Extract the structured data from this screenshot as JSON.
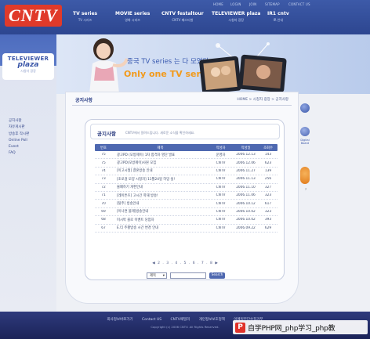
{
  "logo": "CNTV",
  "utility_links": [
    "HOME",
    "LOGIN",
    "JOIN",
    "SITEMAP",
    "CONTACT US"
  ],
  "nav": [
    {
      "label": "TV series",
      "sub": "TV 시리즈"
    },
    {
      "label": "MOVIE series",
      "sub": "영화 시리즈"
    },
    {
      "label": "CNTV festaltour",
      "sub": "CNTV 페스티벌"
    },
    {
      "label": "TELEVIEWER plaza",
      "sub": "시청자 광장"
    },
    {
      "label": "IR1 cntv",
      "sub": "IR 안내"
    }
  ],
  "sidebar": {
    "logo_top": "TELEVIEWER",
    "logo_mid": "plaza",
    "logo_sub": "시청자 광장",
    "items": [
      {
        "label": "공지사항"
      },
      {
        "label": "자유게시판"
      },
      {
        "label": "방송후 작시판"
      },
      {
        "label": "Online Poll"
      },
      {
        "label": "Event"
      },
      {
        "label": "FAQ"
      }
    ]
  },
  "banner": {
    "slogan_ko": "중국 TV series 는 다 모였다",
    "slogan_en": "Only one TV series!"
  },
  "page_title": "공지사항",
  "breadcrumb": "HOME > 시청자 광장 > 공지사항",
  "board": {
    "title": "공지사항",
    "description": "CNTV에서 알려드립니다. 새로운 소식을 확인하세요.",
    "columns": [
      "번호",
      "제목",
      "작성자",
      "작성일",
      "조회수"
    ],
    "rows": [
      {
        "no": "75",
        "title": "광고PD (모방제이) 1차 합격자 명단 발표",
        "author": "운영자",
        "date": "2006.12.13",
        "views": "143"
      },
      {
        "no": "75",
        "title": "광고PD(모방제이)사원 모집",
        "author": "CNTV",
        "date": "2006.12.06",
        "views": "623"
      },
      {
        "no": "74",
        "title": "[이고시절] 결혼방송 안내",
        "author": "CNTV",
        "date": "2006.11.27",
        "views": "139"
      },
      {
        "no": "73",
        "title": "[조로걸 모양 시청자] 11월24일 하망 실!",
        "author": "CNTV",
        "date": "2006.11.13",
        "views": "256"
      },
      {
        "no": "72",
        "title": "물폐하기 개편안내",
        "author": "CNTV",
        "date": "2006.11.10",
        "views": "327"
      },
      {
        "no": "71",
        "title": "[레이튼즈] 고시간 학재 방송!",
        "author": "CNTV",
        "date": "2006.11.06",
        "views": "323"
      },
      {
        "no": "70",
        "title": "[탈주] 방송안내",
        "author": "CNTV",
        "date": "2006.10.12",
        "views": "617"
      },
      {
        "no": "69",
        "title": "[이나면 불래]방송안내",
        "author": "CNTV",
        "date": "2006.10.02",
        "views": "323"
      },
      {
        "no": "68",
        "title": "미시박 블로 이벤트 당첨자",
        "author": "CNTV",
        "date": "2006.10.02",
        "views": "393"
      },
      {
        "no": "67",
        "title": "E.티 주황방송 시간 변경 안내",
        "author": "CNTV",
        "date": "2006.09.22",
        "views": "629"
      }
    ],
    "pagination": "◀ 2 . 3 . 4 . 5 . 6 . 7 . 8 ▶",
    "search_select": "제목",
    "search_button": "Search"
  },
  "right_widgets": {
    "label": "Digital Board",
    "bottom": "7"
  },
  "footer": {
    "links": [
      "회사정보바로가기",
      "Contact US",
      "CNTV패밀리",
      "개인정보보호정책",
      "이메일무단수집거부"
    ],
    "copyright": "Copyright (c) 2006 CNTV. All Rights Reserved."
  },
  "watermark": "自学PHP网_php学习_php教",
  "colors": {
    "accent": "#4e68b0",
    "brand": "#e03a2a",
    "slogan": "#f29a1c"
  }
}
